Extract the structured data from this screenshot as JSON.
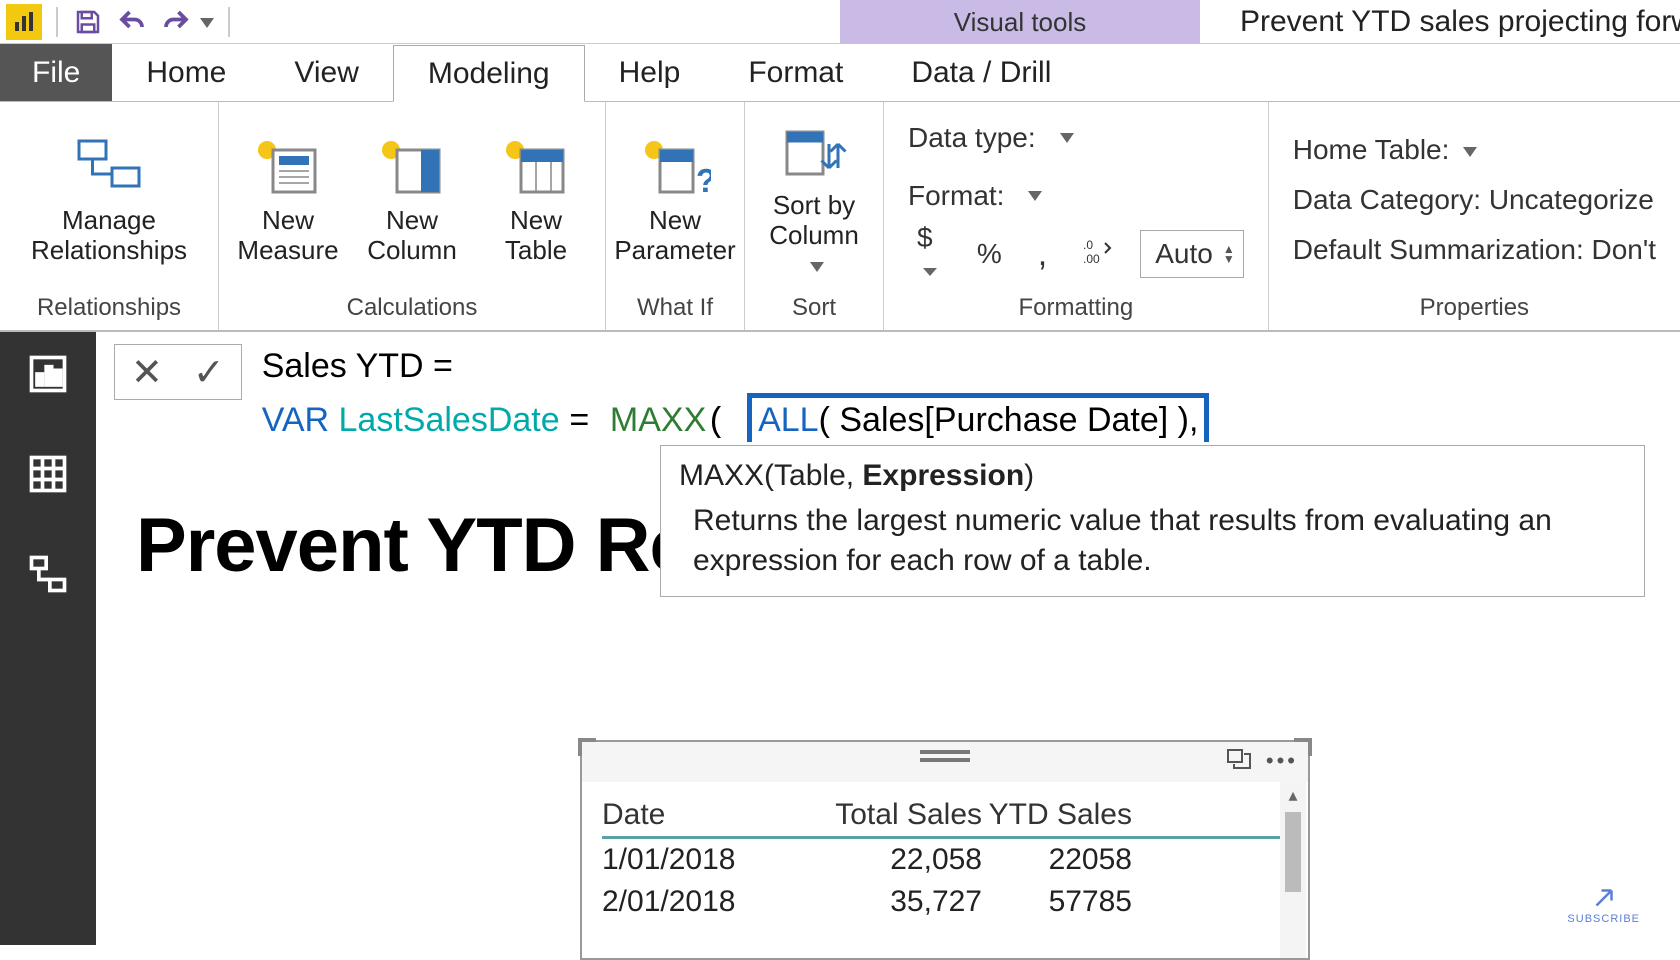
{
  "titleBar": {
    "contextTab": "Visual tools",
    "documentTitle": "Prevent YTD sales projecting forwa"
  },
  "tabs": {
    "file": "File",
    "home": "Home",
    "view": "View",
    "modeling": "Modeling",
    "help": "Help",
    "format": "Format",
    "dataDrill": "Data / Drill"
  },
  "ribbon": {
    "relationships": {
      "manage": "Manage\nRelationships",
      "groupLabel": "Relationships"
    },
    "calculations": {
      "newMeasure": "New\nMeasure",
      "newColumn": "New\nColumn",
      "newTable": "New\nTable",
      "groupLabel": "Calculations"
    },
    "whatif": {
      "newParameter": "New\nParameter",
      "groupLabel": "What If"
    },
    "sort": {
      "sortByColumn": "Sort by\nColumn",
      "groupLabel": "Sort"
    },
    "formatting": {
      "dataTypeLabel": "Data type:",
      "formatLabel": "Format:",
      "currency": "$",
      "percent": "%",
      "thousands": ",",
      "decimal": ".00",
      "auto": "Auto",
      "groupLabel": "Formatting"
    },
    "properties": {
      "homeTable": "Home Table:",
      "dataCategory": "Data Category: Uncategorize",
      "defaultSum": "Default Summarization: Don't",
      "groupLabel": "Properties"
    }
  },
  "formula": {
    "line1_name": "Sales YTD",
    "equals": " = ",
    "var": "VAR",
    "varName": " LastSalesDate ",
    "maxx": "MAXX",
    "all": "ALL",
    "tableRef": "Sales[Purchase Date]",
    "tooltipSig_fn": "MAXX",
    "tooltipSig_arg1": "Table",
    "tooltipSig_arg2": "Expression",
    "tooltipDesc": "Returns the largest numeric value that results from evaluating an expression for each row of a table."
  },
  "canvas": {
    "pageTitle": "Prevent YTD Results Projecting Forw"
  },
  "table": {
    "headers": {
      "c1": "Date",
      "c2": "Total Sales",
      "c3": "YTD Sales"
    },
    "rows": [
      {
        "c1": "1/01/2018",
        "c2": "22,058",
        "c3": "22058"
      },
      {
        "c1": "2/01/2018",
        "c2": "35,727",
        "c3": "57785"
      }
    ]
  },
  "subscribe": "SUBSCRIBE"
}
